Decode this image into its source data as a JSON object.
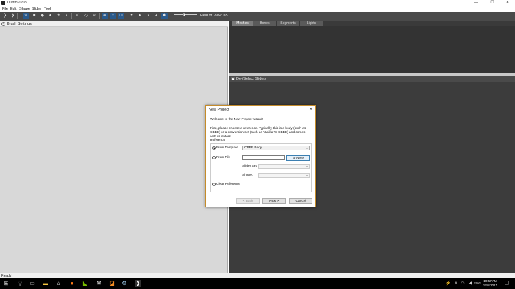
{
  "window": {
    "title": "OutfitStudio",
    "controls": {
      "minimize": "—",
      "maximize": "☐",
      "close": "✕"
    }
  },
  "menu": [
    "File",
    "Edit",
    "Shape",
    "Slider",
    "Tool"
  ],
  "toolbar": {
    "field_of_view_label": "Field of View: 65",
    "icons": [
      "select-brush",
      "transform-brush",
      "standard-brush",
      "deflate-brush",
      "move-brush",
      "smooth-brush",
      "undiff-brush",
      "weight-brush",
      "color-brush",
      "alpha-brush",
      "xmirror-toggle",
      "connected-toggle",
      "global-toggle",
      "vertex-toggle",
      "wireframe-toggle",
      "lighting-toggle",
      "texture-toggle",
      "ghost-toggle"
    ]
  },
  "left_panel": {
    "brush_settings_label": "Brush Settings",
    "expander_glyph": "−"
  },
  "right_panel": {
    "tabs": [
      "Meshes",
      "Bones",
      "Segments",
      "Lights"
    ],
    "active_tab": "Meshes",
    "sliders_header": "De-/Select Sliders",
    "sliders_checked": true,
    "checkbox_glyph": "✓"
  },
  "status": {
    "text": "Ready!"
  },
  "dialog": {
    "title": "New Project",
    "close_glyph": "✕",
    "welcome": "Welcome to the New Project wizard!",
    "description": "First, please choose a reference. Typically, this is a body (such as CBBE) or a conversion set (such as Vanilla To CBBE) and comes with its sliders.",
    "reference_group_label": "Reference",
    "options": {
      "from_template": "From Template",
      "from_file": "From File",
      "clear_reference": "Clear Reference"
    },
    "selected_option": "from_template",
    "template_value": "CBBE Body",
    "file_path_value": "",
    "browse_label": "Browse",
    "slider_set_label": "Slider Set:",
    "shape_label": "Shape:",
    "dropdown_arrow": "▾",
    "buttons": {
      "back": "< Back",
      "next": "Next >",
      "cancel": "Cancel"
    }
  },
  "taskbar": {
    "start_icon": "windows-start-icon",
    "icons": [
      "search-icon",
      "task-view-icon",
      "file-explorer-icon",
      "store-icon",
      "firefox-icon",
      "nvidia-icon",
      "mail-icon",
      "sublime-icon",
      "steam-icon",
      "outfitstudio-icon"
    ],
    "tray": {
      "language": "ENG",
      "time": "10:57 AM",
      "date": "12/8/2017"
    }
  },
  "colors": {
    "toolbar_bg": "#4a4a4a",
    "panel_dark": "#3c3c3c",
    "dialog_border": "#c48b2a",
    "accent_blue": "#3c7fb1"
  }
}
